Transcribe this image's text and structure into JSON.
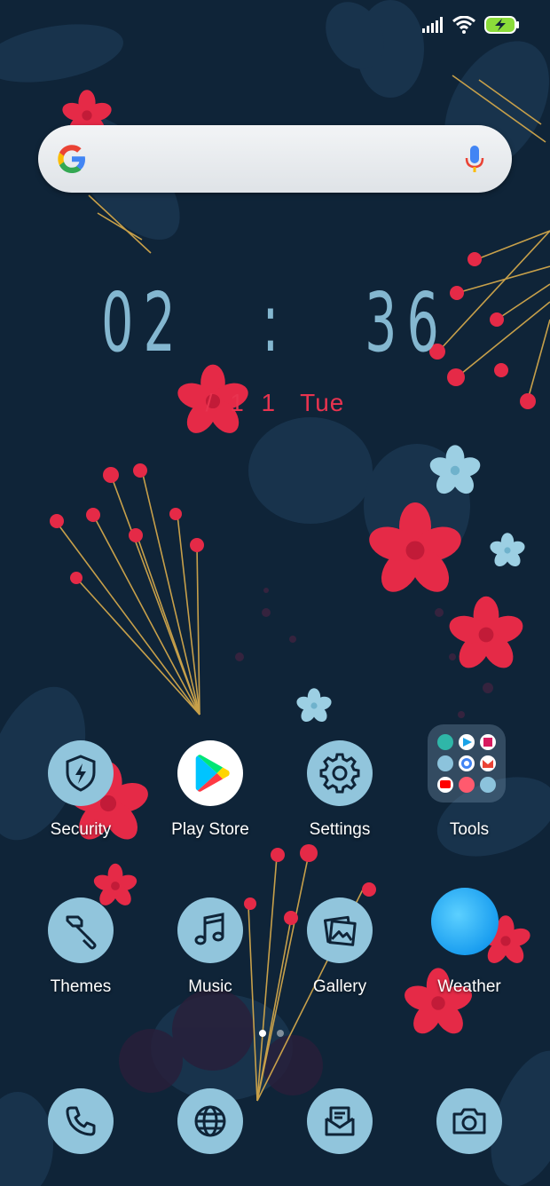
{
  "status_bar": {
    "icons": [
      "signal-icon",
      "wifi-icon",
      "battery-charging-icon"
    ],
    "battery_color": "#8bdc3a"
  },
  "search_bar": {
    "placeholder": "",
    "icons": [
      "google-logo-icon",
      "microphone-icon"
    ]
  },
  "clock": {
    "time_hours": "02",
    "time_separator": ":",
    "time_minutes": "36",
    "date": "/ 1 1",
    "day": "Tue"
  },
  "apps": [
    {
      "label": "Security",
      "icon": "shield-bolt-icon"
    },
    {
      "label": "Play Store",
      "icon": "play-store-icon"
    },
    {
      "label": "Settings",
      "icon": "gear-icon"
    },
    {
      "label": "Tools",
      "icon": "folder-icon"
    },
    {
      "label": "Themes",
      "icon": "paintbrush-icon"
    },
    {
      "label": "Music",
      "icon": "music-note-icon"
    },
    {
      "label": "Gallery",
      "icon": "gallery-icon"
    },
    {
      "label": "Weather",
      "icon": "weather-icon"
    }
  ],
  "dock": [
    {
      "icon": "phone-icon"
    },
    {
      "icon": "globe-icon"
    },
    {
      "icon": "messages-icon"
    },
    {
      "icon": "camera-icon"
    }
  ],
  "page_indicator": {
    "total": 2,
    "current": 1
  },
  "colors": {
    "background": "#0f2438",
    "icon_disc": "#91c5dc",
    "accent_red": "#e8334f",
    "clock": "#8cc0d8"
  }
}
